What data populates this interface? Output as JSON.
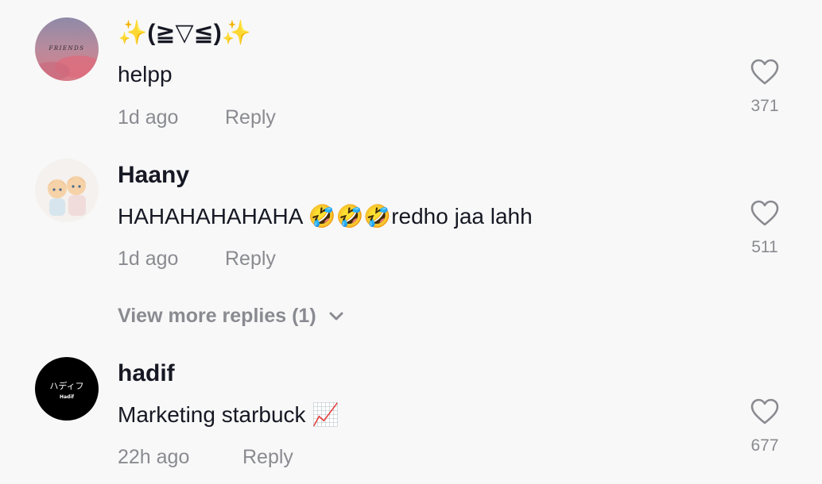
{
  "comments": [
    {
      "username": "✨(≧▽≦)✨",
      "text": "helpp",
      "time": "1d ago",
      "reply_label": "Reply",
      "likes": "371",
      "avatar_text": "FRIENDS"
    },
    {
      "username": "Haany",
      "text": "HAHAHAHAHAHA 🤣🤣🤣redho jaa lahh",
      "time": "1d ago",
      "reply_label": "Reply",
      "likes": "511"
    },
    {
      "username": "hadif",
      "text": "Marketing starbuck 📈",
      "time": "22h ago",
      "reply_label": "Reply",
      "likes": "677",
      "avatar_text": "ハディフ",
      "avatar_subtext": "Hadif"
    }
  ],
  "view_more": {
    "label": "View more replies (1)"
  },
  "colors": {
    "background": "#f8f8f8",
    "primary_text": "#161823",
    "secondary_text": "#8a8b91"
  }
}
